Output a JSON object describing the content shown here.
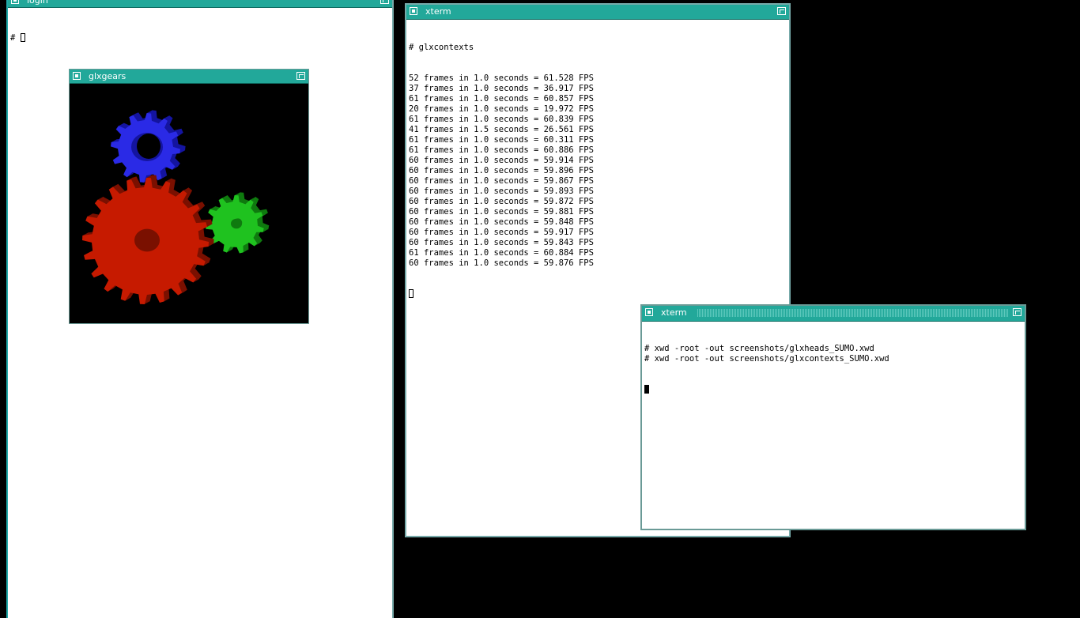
{
  "windows": {
    "login": {
      "title": "login",
      "prompt": "# "
    },
    "glxgears": {
      "title": "glxgears",
      "gear_colors": {
        "red": "#c61a00",
        "green": "#1fc21f",
        "blue": "#2a2ae6"
      }
    },
    "xterm1": {
      "title": "xterm",
      "command": "# glxcontexts",
      "lines": [
        "52 frames in 1.0 seconds = 61.528 FPS",
        "37 frames in 1.0 seconds = 36.917 FPS",
        "61 frames in 1.0 seconds = 60.857 FPS",
        "20 frames in 1.0 seconds = 19.972 FPS",
        "61 frames in 1.0 seconds = 60.839 FPS",
        "41 frames in 1.5 seconds = 26.561 FPS",
        "61 frames in 1.0 seconds = 60.311 FPS",
        "61 frames in 1.0 seconds = 60.886 FPS",
        "60 frames in 1.0 seconds = 59.914 FPS",
        "60 frames in 1.0 seconds = 59.896 FPS",
        "60 frames in 1.0 seconds = 59.867 FPS",
        "60 frames in 1.0 seconds = 59.893 FPS",
        "60 frames in 1.0 seconds = 59.872 FPS",
        "60 frames in 1.0 seconds = 59.881 FPS",
        "60 frames in 1.0 seconds = 59.848 FPS",
        "60 frames in 1.0 seconds = 59.917 FPS",
        "60 frames in 1.0 seconds = 59.843 FPS",
        "61 frames in 1.0 seconds = 60.884 FPS",
        "60 frames in 1.0 seconds = 59.876 FPS"
      ]
    },
    "xterm2": {
      "title": "xterm",
      "lines": [
        "# xwd -root -out screenshots/glxheads_SUMO.xwd",
        "# xwd -root -out screenshots/glxcontexts_SUMO.xwd"
      ]
    }
  },
  "colors": {
    "titlebar": "#22a89a",
    "desktop": "#000000",
    "terminal_bg": "#ffffff"
  }
}
